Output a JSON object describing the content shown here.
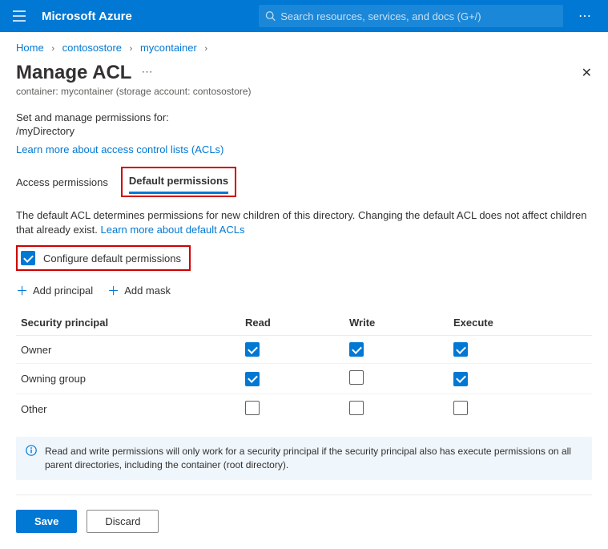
{
  "header": {
    "brand": "Microsoft Azure",
    "search_placeholder": "Search resources, services, and docs (G+/)"
  },
  "breadcrumb": {
    "items": [
      "Home",
      "contosostore",
      "mycontainer"
    ]
  },
  "page": {
    "title": "Manage ACL",
    "subtitle": "container: mycontainer (storage account: contosostore)",
    "intro": "Set and manage permissions for:",
    "path": "/myDirectory",
    "learn_link": "Learn more about access control lists (ACLs)"
  },
  "tabs": {
    "access": "Access permissions",
    "default": "Default permissions"
  },
  "description": {
    "text": "The default ACL determines permissions for new children of this directory. Changing the default ACL does not affect children that already exist. ",
    "link": "Learn more about default ACLs"
  },
  "configure": {
    "label": "Configure default permissions",
    "checked": true
  },
  "actions": {
    "add_principal": "Add principal",
    "add_mask": "Add mask"
  },
  "table": {
    "headers": {
      "principal": "Security principal",
      "read": "Read",
      "write": "Write",
      "execute": "Execute"
    },
    "rows": [
      {
        "name": "Owner",
        "read": true,
        "write": true,
        "execute": true
      },
      {
        "name": "Owning group",
        "read": true,
        "write": false,
        "execute": true
      },
      {
        "name": "Other",
        "read": false,
        "write": false,
        "execute": false
      }
    ]
  },
  "info": {
    "text": "Read and write permissions will only work for a security principal if the security principal also has execute permissions on all parent directories, including the container (root directory)."
  },
  "buttons": {
    "save": "Save",
    "discard": "Discard"
  }
}
